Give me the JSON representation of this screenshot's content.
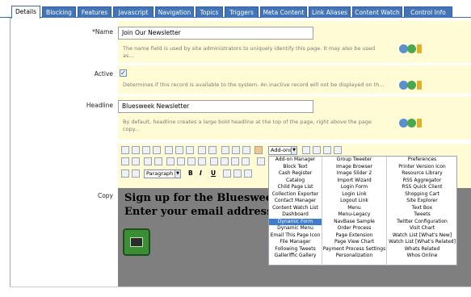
{
  "tabs": [
    "Details",
    "Blocking",
    "Features",
    "Javascript",
    "Navigation",
    "Topics",
    "Triggers",
    "Meta Content",
    "Link Aliases",
    "Content Watch",
    "Control Info"
  ],
  "active_tab": "Details",
  "fields": {
    "name": {
      "label": "*Name",
      "value": "Join Our Newsletter",
      "help_line1": "The name field is used by site administrators to uniquely identify this page. It may also be used",
      "help_line2": "as..."
    },
    "active": {
      "label": "Active",
      "checked": "✓",
      "help": "Determines if this record is available to the system. An inactive record will not be displayed on th..."
    },
    "headline": {
      "label": "Headline",
      "value": "Bluesweek Newsletter",
      "help_line1": "By default, headline creates a large bold headline at the top of the page, right above the page",
      "help_line2": "copy..."
    },
    "copy": {
      "label": "Copy"
    }
  },
  "editor": {
    "addons_select": "Add-ons",
    "paragraph_select": "Paragraph",
    "bold": "B",
    "italic": "I",
    "underline": "U",
    "content_line1": "Sign up for the Bluesweek Ne",
    "content_line2": "Enter your email address bel"
  },
  "addons_menu": {
    "col1": [
      "Add-on Manager",
      "Block Text",
      "Cash Register",
      "Catalog",
      "Child Page List",
      "Collection Exporter",
      "Contact Manager",
      "Content Watch List",
      "Dashboard",
      "Dynamic Form",
      "Dynamic Menu",
      "Email This Page Icon",
      "File Manager",
      "Following Tweets",
      "Galleriffic Gallery"
    ],
    "col2": [
      "Group Tweeter",
      "Image Browser",
      "Image Slider 2",
      "Import Wizard",
      "Login Form",
      "Login Link",
      "Logout Link",
      "Menu",
      "Menu-Legacy",
      "NavBase Sample",
      "Order Process",
      "Page Extension",
      "Page View Chart",
      "Payment Process Settings",
      "Personalization"
    ],
    "col3": [
      "Preferences",
      "Printer Version Icon",
      "Resource Library",
      "RSS Aggregator",
      "RSS Quick Client",
      "Shopping Cart",
      "Site Explorer",
      "Text Box",
      "Tweets",
      "Twitter Configuration",
      "Visit Chart",
      "Watch List [What's New]",
      "Watch List [What's Related]",
      "Whats Related",
      "Whos Online"
    ],
    "highlighted": "Dynamic Form"
  }
}
